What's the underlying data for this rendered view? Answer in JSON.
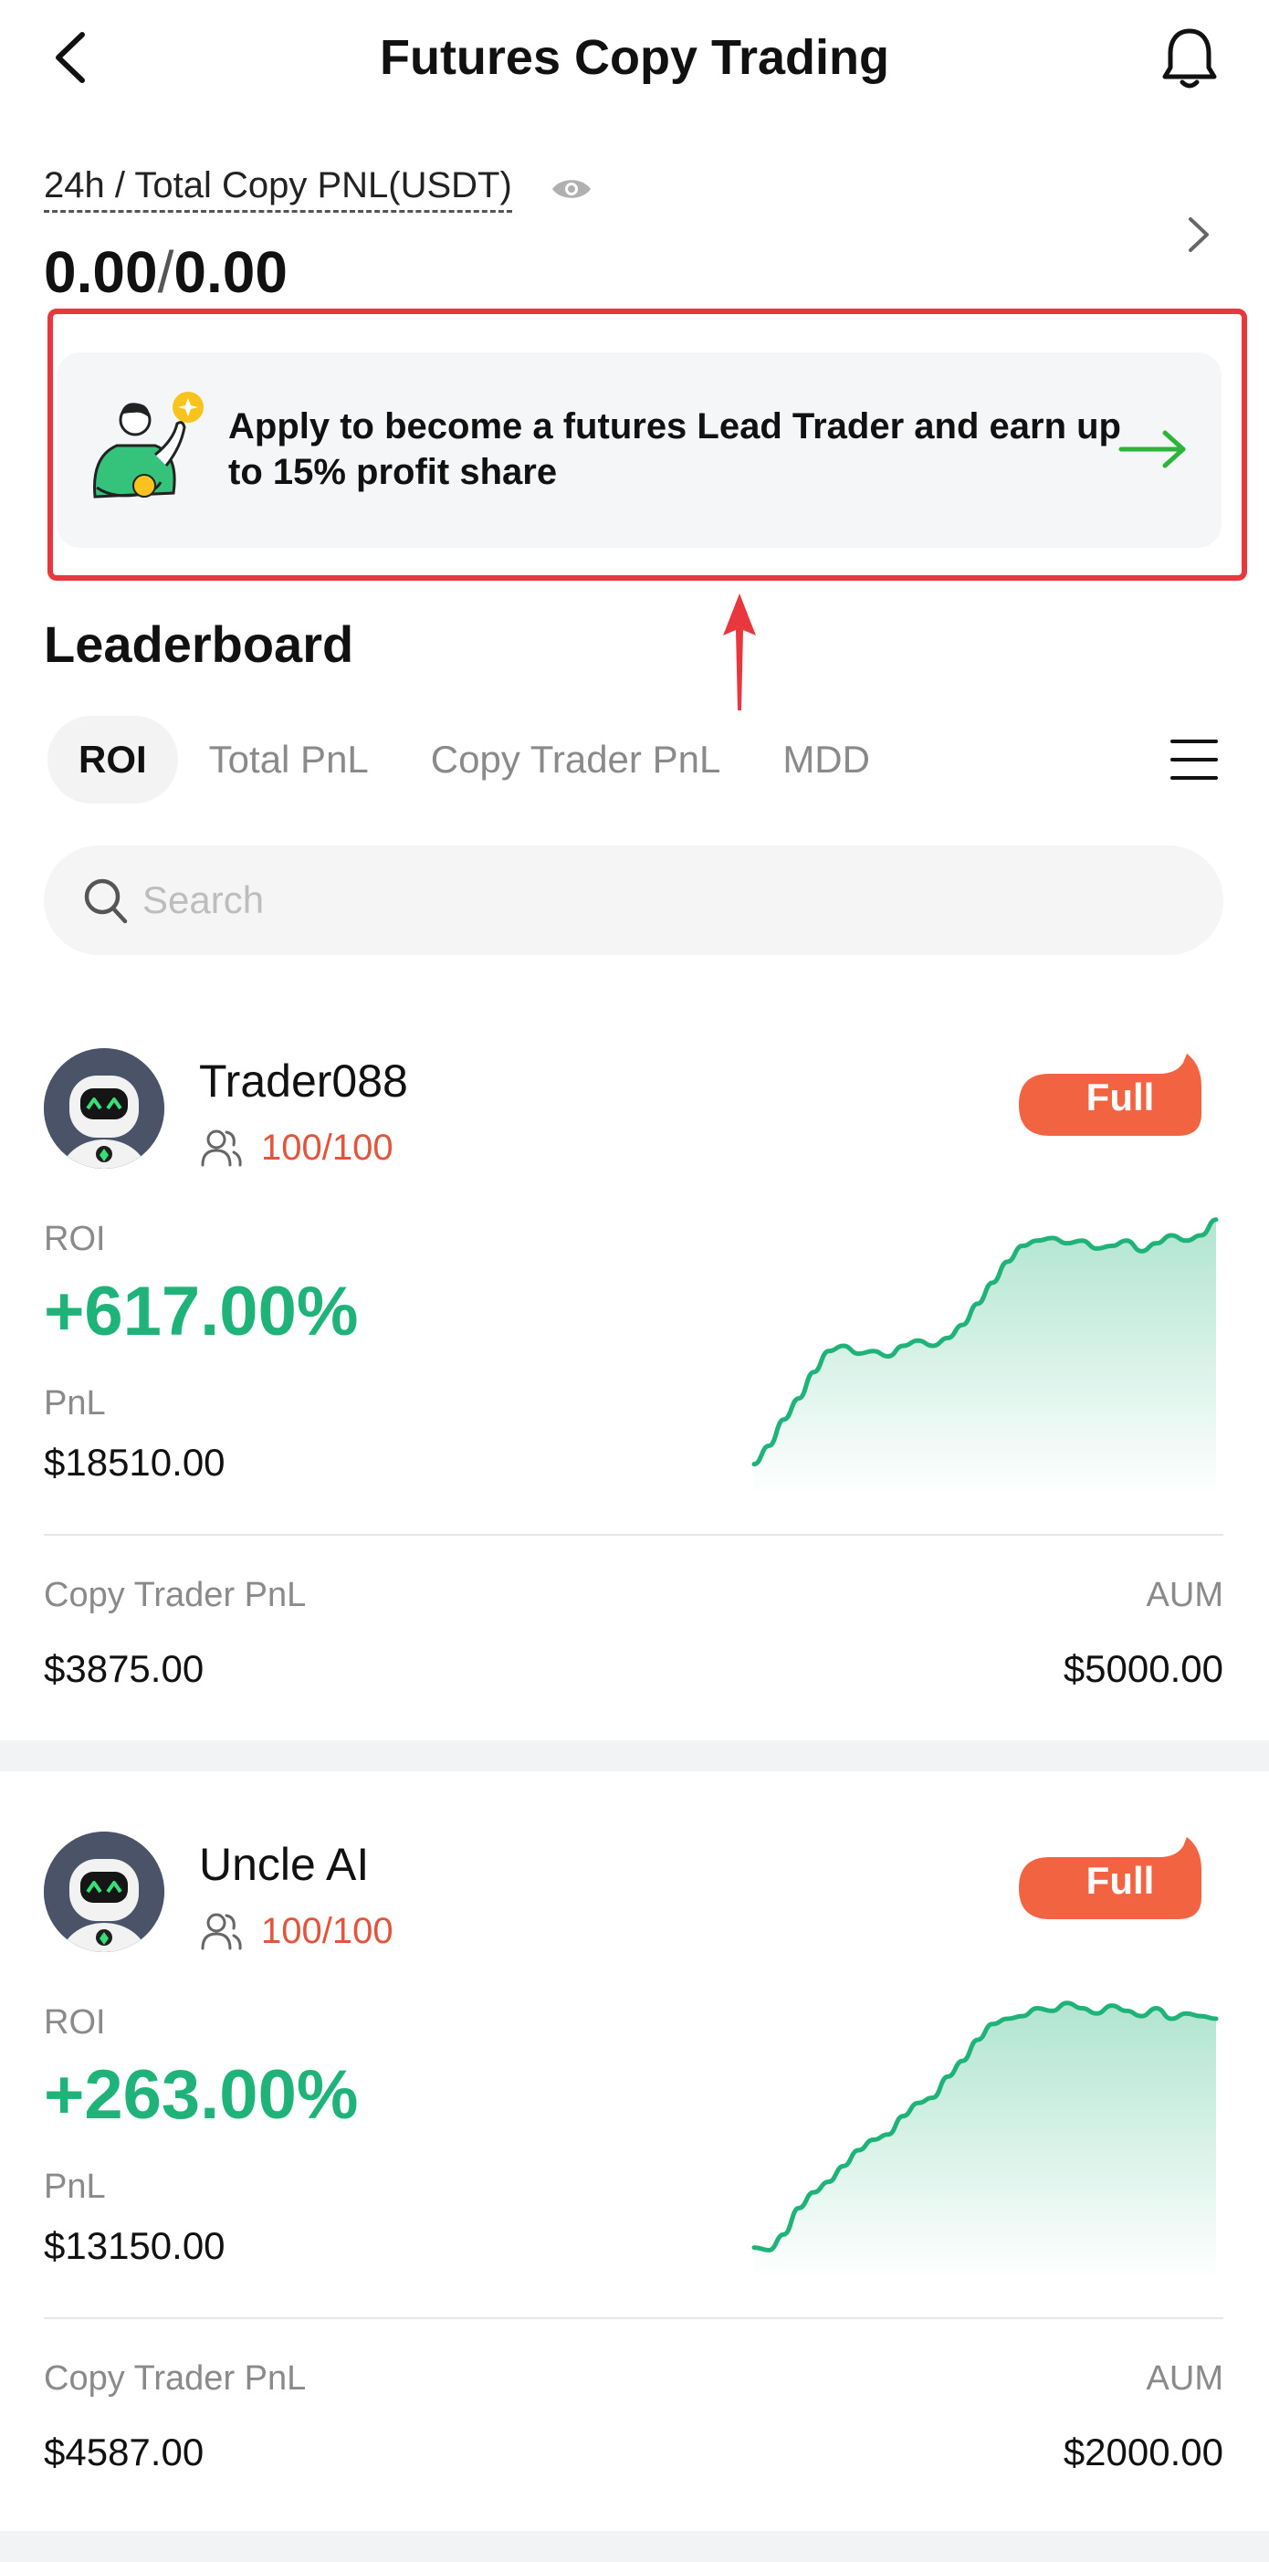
{
  "header": {
    "title": "Futures Copy Trading",
    "back_icon": "back-chevron-icon",
    "bell_icon": "bell-icon"
  },
  "summary": {
    "label": "24h / Total Copy PNL(USDT)",
    "value_24h": "0.00",
    "separator": "/",
    "value_total": "0.00"
  },
  "banner": {
    "text": "Apply to become a futures Lead Trader and earn up to 15% profit share",
    "arrow_color": "#2db53a"
  },
  "leaderboard": {
    "title": "Leaderboard",
    "tabs": [
      {
        "label": "ROI",
        "active": true
      },
      {
        "label": "Total PnL",
        "active": false
      },
      {
        "label": "Copy Trader PnL",
        "active": false
      },
      {
        "label": "MDD",
        "active": false
      }
    ],
    "search_placeholder": "Search"
  },
  "labels": {
    "roi": "ROI",
    "pnl": "PnL",
    "copy_trader_pnl": "Copy Trader PnL",
    "aum": "AUM",
    "full": "Full"
  },
  "traders": [
    {
      "name": "Trader088",
      "followers": "100/100",
      "roi": "+617.00%",
      "pnl": "$18510.00",
      "copy_trader_pnl": "$3875.00",
      "aum": "$5000.00",
      "spark": [
        5,
        12,
        22,
        30,
        40,
        48,
        50,
        47,
        48,
        46,
        50,
        52,
        50,
        53,
        58,
        66,
        74,
        82,
        88,
        90,
        91,
        89,
        90,
        87,
        88,
        90,
        86,
        89,
        92,
        90,
        92,
        98
      ]
    },
    {
      "name": "Uncle AI",
      "followers": "100/100",
      "roi": "+263.00%",
      "pnl": "$13150.00",
      "copy_trader_pnl": "$4587.00",
      "aum": "$2000.00",
      "spark": [
        5,
        4,
        10,
        20,
        26,
        30,
        36,
        42,
        46,
        48,
        55,
        60,
        62,
        70,
        76,
        84,
        90,
        92,
        93,
        96,
        95,
        98,
        96,
        94,
        97,
        95,
        93,
        96,
        92,
        94,
        93,
        92
      ]
    }
  ],
  "colors": {
    "accent_green": "#1fb37a",
    "full_badge": "#f26341",
    "followers_text": "#e0553c",
    "highlight_red": "#e8383d"
  }
}
